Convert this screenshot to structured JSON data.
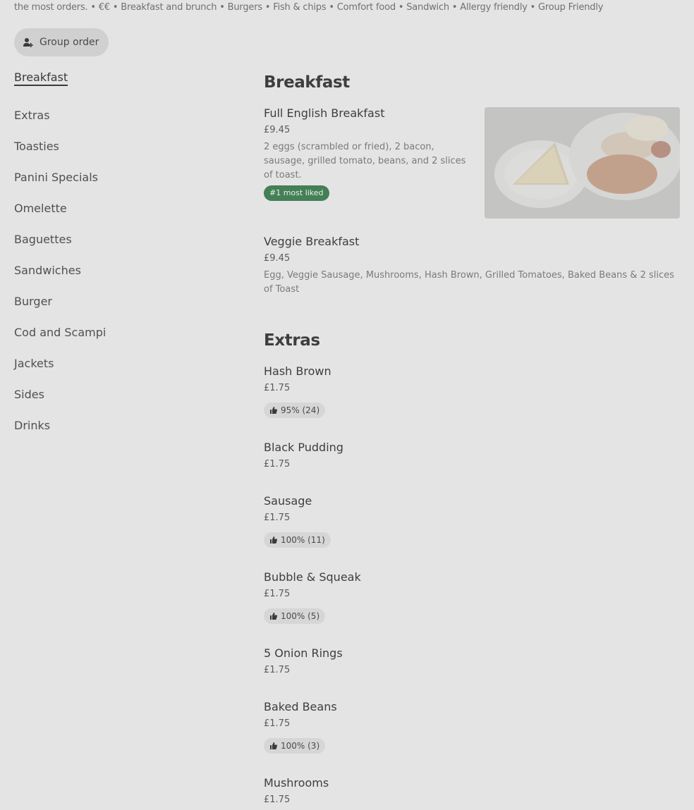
{
  "tagline": "the most orders. • €€ • Breakfast and brunch • Burgers • Fish & chips • Comfort food • Sandwich • Allergy friendly • Group Friendly",
  "group_order": {
    "label": "Group order",
    "icon": "person-add-icon"
  },
  "sidebar": {
    "items": [
      {
        "label": "Breakfast",
        "active": true
      },
      {
        "label": "Extras"
      },
      {
        "label": "Toasties"
      },
      {
        "label": "Panini Specials"
      },
      {
        "label": "Omelette"
      },
      {
        "label": "Baguettes"
      },
      {
        "label": "Sandwiches"
      },
      {
        "label": "Burger"
      },
      {
        "label": "Cod and Scampi"
      },
      {
        "label": "Jackets"
      },
      {
        "label": "Sides"
      },
      {
        "label": "Drinks"
      }
    ]
  },
  "sections": {
    "breakfast": {
      "title": "Breakfast",
      "items": [
        {
          "name": "Full English Breakfast",
          "price": "£9.45",
          "description": "2 eggs (scrambled or fried), 2 bacon, sausage, grilled tomato, beans, and 2 slices of toast.",
          "badge": "#1 most liked"
        },
        {
          "name": "Veggie Breakfast",
          "price": "£9.45",
          "description": "Egg, Veggie Sausage, Mushrooms, Hash Brown, Grilled Tomatoes, Baked Beans & 2 slices of Toast"
        }
      ]
    },
    "extras": {
      "title": "Extras",
      "items": [
        {
          "name": "Hash Brown",
          "price": "£1.75",
          "rating": "95% (24)"
        },
        {
          "name": "Black Pudding",
          "price": "£1.75"
        },
        {
          "name": "Sausage",
          "price": "£1.75",
          "rating": "100% (11)"
        },
        {
          "name": "Bubble & Squeak",
          "price": "£1.75",
          "rating": "100% (5)"
        },
        {
          "name": "5 Onion Rings",
          "price": "£1.75"
        },
        {
          "name": "Baked Beans",
          "price": "£1.75",
          "rating": "100% (3)"
        },
        {
          "name": "Mushrooms",
          "price": "£1.75"
        }
      ]
    }
  },
  "colors": {
    "overlay_bg": "#e4e4e4",
    "badge_green": "#447f55"
  }
}
